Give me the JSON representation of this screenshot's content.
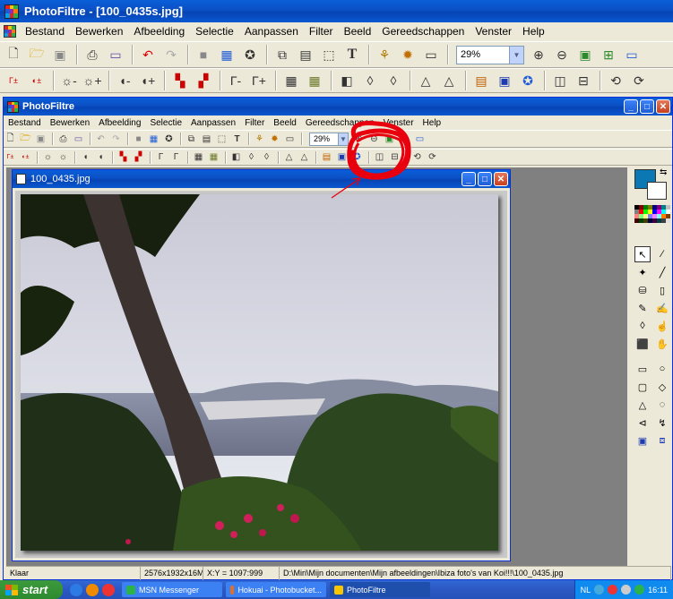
{
  "window": {
    "title": "PhotoFiltre - [100_0435s.jpg]"
  },
  "outer_menu": [
    "Bestand",
    "Bewerken",
    "Afbeelding",
    "Selectie",
    "Aanpassen",
    "Filter",
    "Beeld",
    "Gereedschappen",
    "Venster",
    "Help"
  ],
  "outer_toolbar": {
    "zoom_value": "29%"
  },
  "inner_window": {
    "title": "PhotoFiltre",
    "menu": [
      "Bestand",
      "Bewerken",
      "Afbeelding",
      "Selectie",
      "Aanpassen",
      "Filter",
      "Beeld",
      "Gereedschappen",
      "Venster",
      "Help"
    ],
    "zoom_value": "29%"
  },
  "image_window": {
    "title": "100_0435.jpg"
  },
  "statusbar": {
    "state": "Klaar",
    "dimensions": "2576x1932x16M",
    "coords": "X:Y = 1097:999",
    "path": "D:\\Miri\\Mijn documenten\\Mijn afbeeldingen\\Ibiza foto's van Koi!!!\\100_0435.jpg"
  },
  "taskbar": {
    "start_label": "start",
    "tasks": [
      "MSN Messenger",
      "Hokuai - Photobucket...",
      "PhotoFiltre"
    ],
    "lang": "NL",
    "clock": "16:11"
  },
  "colors": {
    "foreground": "#0b78b4",
    "background": "#ffffff",
    "annotation": "#e8000e"
  }
}
